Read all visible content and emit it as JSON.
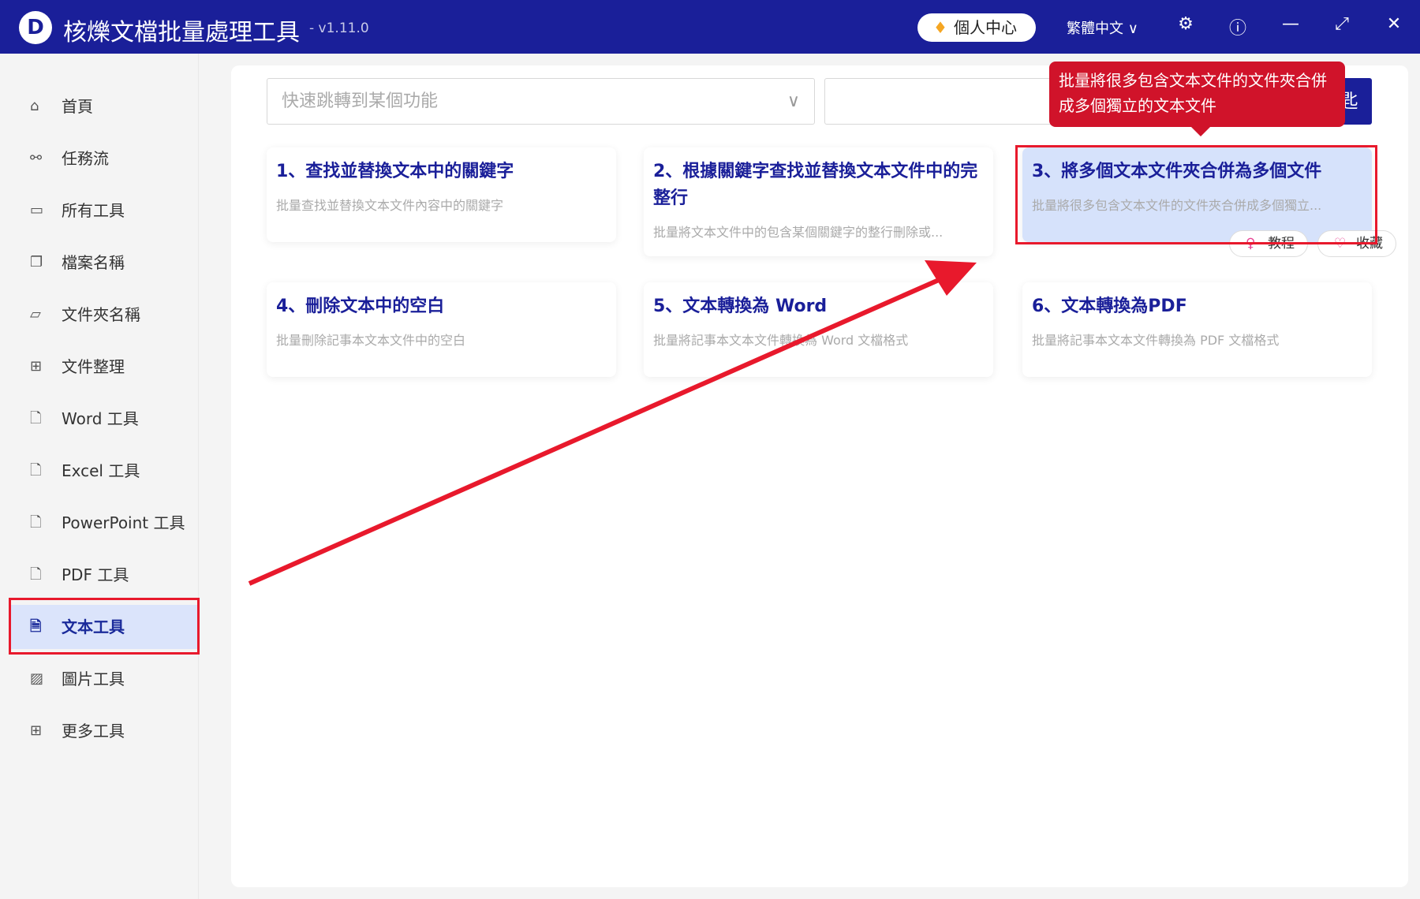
{
  "titlebar": {
    "logo": "D",
    "title": "核爍文檔批量處理工具",
    "version": "- v1.11.0",
    "vip": "個人中心",
    "language": "繁體中文"
  },
  "sidebar": {
    "items": [
      {
        "label": "首頁",
        "icon": "home-icon"
      },
      {
        "label": "任務流",
        "icon": "workflow-icon"
      },
      {
        "label": "所有工具",
        "icon": "monitor-icon"
      },
      {
        "label": "檔案名稱",
        "icon": "file-icon"
      },
      {
        "label": "文件夾名稱",
        "icon": "folder-icon"
      },
      {
        "label": "文件整理",
        "icon": "organize-icon"
      },
      {
        "label": "Word 工具",
        "icon": "word-icon"
      },
      {
        "label": "Excel 工具",
        "icon": "excel-icon"
      },
      {
        "label": "PowerPoint 工具",
        "icon": "ppt-icon"
      },
      {
        "label": "PDF 工具",
        "icon": "pdf-icon"
      },
      {
        "label": "文本工具",
        "icon": "text-icon"
      },
      {
        "label": "圖片工具",
        "icon": "image-icon"
      },
      {
        "label": "更多工具",
        "icon": "grid-icon"
      }
    ]
  },
  "search": {
    "placeholder": "快速跳轉到某個功能",
    "button": "匙"
  },
  "cards": [
    {
      "title": "1、查找並替換文本中的關鍵字",
      "desc": "批量查找並替換文本文件內容中的關鍵字"
    },
    {
      "title": "2、根據關鍵字查找並替換文本文件中的完整行",
      "desc": "批量將文本文件中的包含某個關鍵字的整行刪除或..."
    },
    {
      "title": "3、將多個文本文件夾合併為多個文件",
      "desc": "批量將很多包含文本文件的文件夾合併成多個獨立..."
    },
    {
      "title": "4、刪除文本中的空白",
      "desc": "批量刪除記事本文本文件中的空白"
    },
    {
      "title": "5、文本轉換為 Word",
      "desc": "批量將記事本文本文件轉換為 Word 文檔格式"
    },
    {
      "title": "6、文本轉換為PDF",
      "desc": "批量將記事本文本文件轉換為 PDF 文檔格式"
    }
  ],
  "card_actions": {
    "tutorial": "教程",
    "favorite": "收藏"
  },
  "tooltip": "批量將很多包含文本文件的文件夾合併成多個獨立的文本文件",
  "colors": {
    "brand": "#1a1f99",
    "highlight": "#e8192c"
  }
}
